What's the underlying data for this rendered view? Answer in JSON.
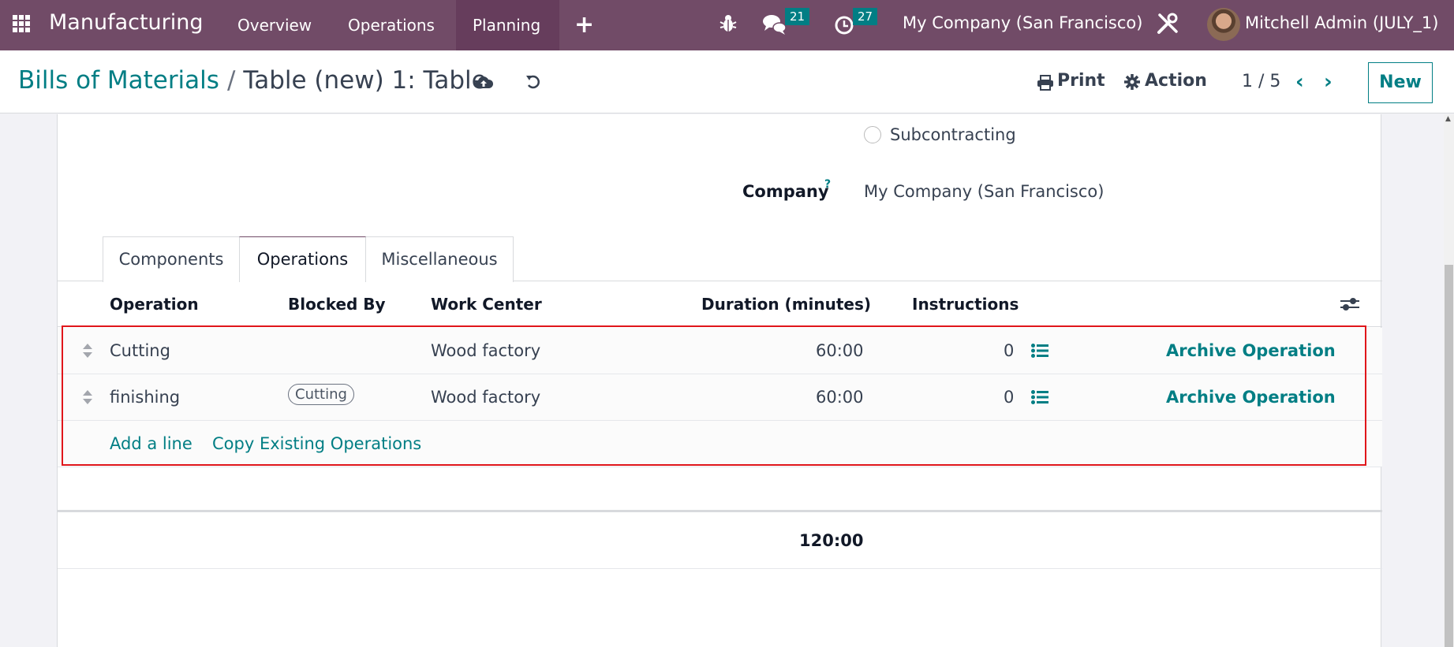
{
  "navbar": {
    "app_name": "Manufacturing",
    "menus": [
      "Overview",
      "Operations",
      "Planning"
    ],
    "active_menu": "Planning",
    "messages_count": "21",
    "activities_count": "27",
    "company": "My Company (San Francisco)",
    "user": "Mitchell Admin (JULY_1)",
    "brand_color": "#714B67"
  },
  "control_panel": {
    "breadcrumb_parent": "Bills of Materials",
    "breadcrumb_separator": "/",
    "breadcrumb_current": "Table (new) 1: Table",
    "print_label": "Print",
    "action_label": "Action",
    "pager": "1 / 5",
    "new_label": "New"
  },
  "form": {
    "bom_type_option": "Subcontracting",
    "company_label": "Company",
    "company_help": "?",
    "company_value": "My Company (San Francisco)"
  },
  "tabs": [
    {
      "label": "Components",
      "active": false
    },
    {
      "label": "Operations",
      "active": true
    },
    {
      "label": "Miscellaneous",
      "active": false
    }
  ],
  "operations_table": {
    "columns": [
      "Operation",
      "Blocked By",
      "Work Center",
      "Duration (minutes)",
      "Instructions"
    ],
    "rows": [
      {
        "operation": "Cutting",
        "blocked_by": "",
        "work_center": "Wood factory",
        "duration": "60:00",
        "instructions": "0",
        "action": "Archive Operation"
      },
      {
        "operation": "finishing",
        "blocked_by": "Cutting",
        "work_center": "Wood factory",
        "duration": "60:00",
        "instructions": "0",
        "action": "Archive Operation"
      }
    ],
    "add_line_label": "Add a line",
    "copy_label": "Copy Existing Operations",
    "total_duration": "120:00"
  },
  "accent_color": "#017e84",
  "highlight_color": "#e0161b"
}
